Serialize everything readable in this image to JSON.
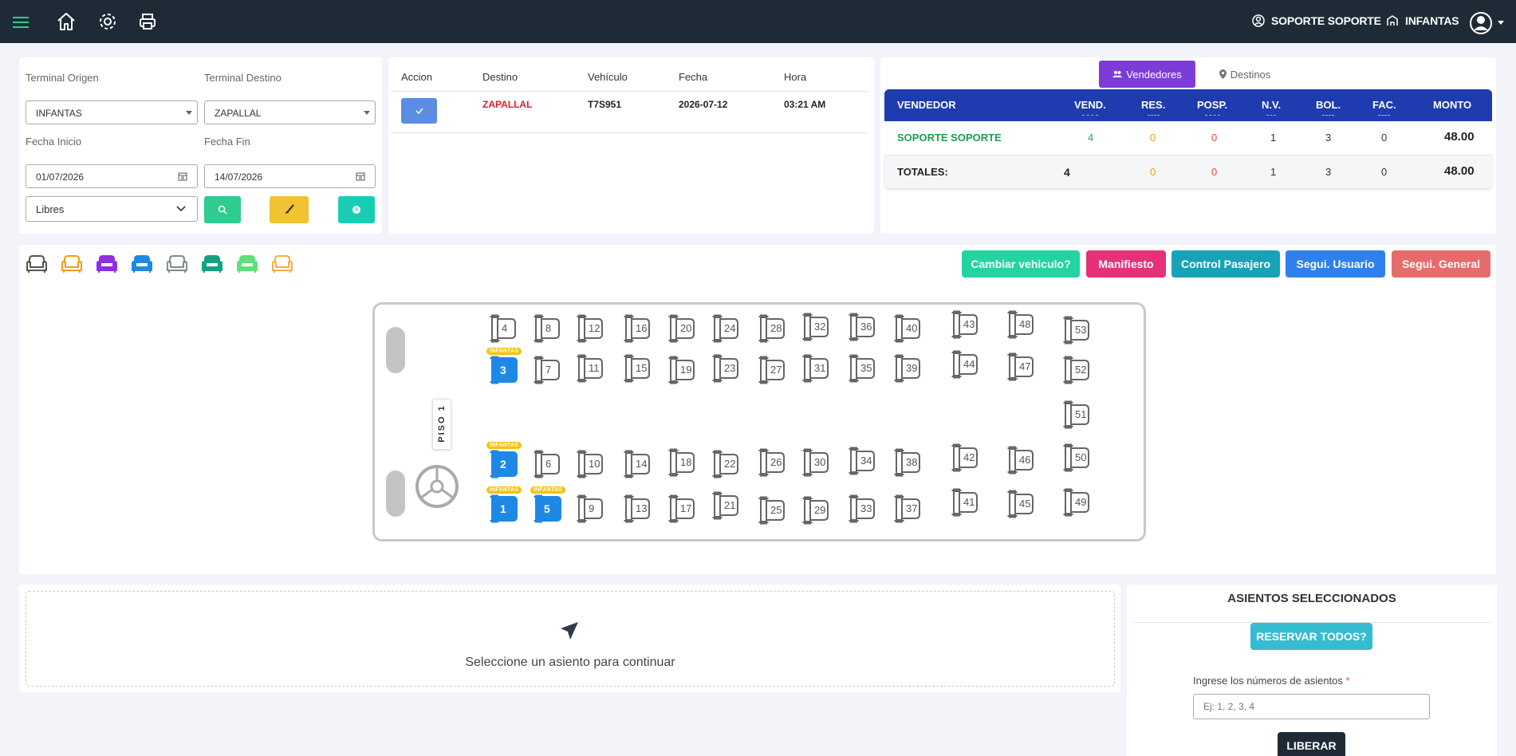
{
  "topbar": {
    "user_label": "SOPORTE SOPORTE",
    "terminal_label": "INFANTAS",
    "icons": [
      "menu-icon",
      "home-icon",
      "gear-icon",
      "print-icon",
      "user-circle-icon",
      "building-icon",
      "avatar-icon"
    ]
  },
  "filters": {
    "origen_label": "Terminal Origen",
    "destino_label": "Terminal Destino",
    "origen_value": "INFANTAS",
    "destino_value": "ZAPALLAL",
    "fecha_inicio_label": "Fecha Inicio",
    "fecha_fin_label": "Fecha Fin",
    "fecha_inicio_value": "01/07/2026",
    "fecha_fin_value": "14/07/2026",
    "estado_value": "Libres"
  },
  "trips": {
    "headers": [
      "Accion",
      "Destino",
      "Vehículo",
      "Fecha",
      "Hora"
    ],
    "rows": [
      {
        "destino": "ZAPALLAL",
        "vehiculo": "T7S951",
        "fecha": "2026-07-12",
        "hora": "03:21 AM"
      }
    ]
  },
  "vendors": {
    "tab_vendedores": "Vendedores",
    "tab_destinos": "Destinos",
    "headers": [
      "VENDEDOR",
      "VEND.",
      "RES.",
      "POSP.",
      "N.V.",
      "BOL.",
      "FAC.",
      "MONTO"
    ],
    "rows": [
      {
        "name": "SOPORTE SOPORTE",
        "vend": "4",
        "res": "0",
        "posp": "0",
        "nv": "1",
        "bol": "3",
        "fac": "0",
        "monto": "48.00"
      }
    ],
    "totals": {
      "label": "TOTALES:",
      "vend": "4",
      "res": "0",
      "posp": "0",
      "nv": "1",
      "bol": "3",
      "fac": "0",
      "monto": "48.00"
    }
  },
  "legend_colors": [
    "#555555",
    "#f39c12",
    "#8e2de2",
    "#1e88e5",
    "#7f8c8d",
    "#16a085",
    "#5ee07a",
    "#f5b041"
  ],
  "actions": {
    "cambiar": "Cambiar vehiculo?",
    "manifiesto": "Manifiesto",
    "control": "Control Pasajero",
    "segui_usuario": "Segui. Usuario",
    "segui_general": "Segui. General"
  },
  "bus": {
    "floor_label": "PISO 1",
    "occupied_tag": "INFANTAS",
    "seats": [
      "1",
      "2",
      "3",
      "4",
      "5",
      "6",
      "7",
      "8",
      "9",
      "10",
      "11",
      "12",
      "13",
      "14",
      "15",
      "16",
      "17",
      "18",
      "19",
      "20",
      "21",
      "22",
      "23",
      "24",
      "25",
      "26",
      "27",
      "28",
      "29",
      "30",
      "31",
      "32",
      "33",
      "34",
      "35",
      "36",
      "37",
      "38",
      "39",
      "40",
      "41",
      "42",
      "43",
      "44",
      "45",
      "46",
      "47",
      "48",
      "49",
      "50",
      "51",
      "52",
      "53"
    ],
    "occupied": [
      "1",
      "2",
      "3",
      "5"
    ]
  },
  "selection": {
    "prompt": "Seleccione un asiento para continuar",
    "title": "ASIENTOS SELECCIONADOS",
    "reservar": "RESERVAR TODOS?",
    "input_label": "Ingrese los números de asientos",
    "required_mark": "*",
    "input_placeholder": "Ej: 1, 2, 3, 4",
    "liberar": "LIBERAR"
  }
}
